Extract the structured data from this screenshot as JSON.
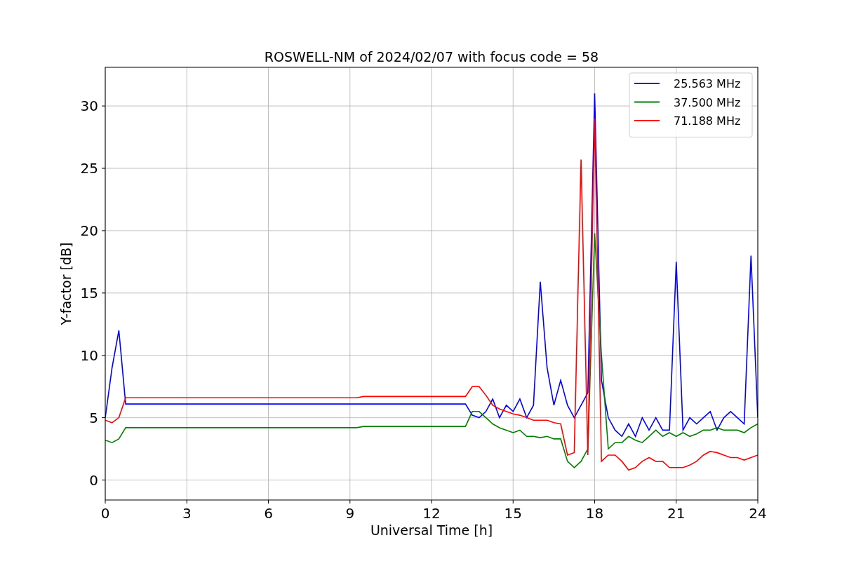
{
  "figure": {
    "chart_data": {
      "type": "line",
      "grid": true,
      "legend": true,
      "title": "ROSWELL-NM of 2024/02/07 with focus code = 58",
      "xlabel": "Universal Time [h]",
      "ylabel": "Y-factor [dB]",
      "xlim": [
        0,
        24
      ],
      "ylim": [
        -1.6,
        33.1
      ],
      "xticks": [
        0,
        3,
        6,
        9,
        12,
        15,
        18,
        21,
        24
      ],
      "yticks": [
        0,
        5,
        10,
        15,
        20,
        25,
        30
      ],
      "x": [
        0,
        0.25,
        0.5,
        0.75,
        1,
        1.25,
        1.5,
        1.75,
        2,
        2.25,
        2.5,
        2.75,
        3,
        3.25,
        3.5,
        3.75,
        4,
        4.25,
        4.5,
        4.75,
        5,
        5.25,
        5.5,
        5.75,
        6,
        6.25,
        6.5,
        6.75,
        7,
        7.25,
        7.5,
        7.75,
        8,
        8.25,
        8.5,
        8.75,
        9,
        9.25,
        9.5,
        9.75,
        10,
        10.25,
        10.5,
        10.75,
        11,
        11.25,
        11.5,
        11.75,
        12,
        12.25,
        12.5,
        12.75,
        13,
        13.25,
        13.5,
        13.75,
        14,
        14.25,
        14.5,
        14.75,
        15,
        15.25,
        15.5,
        15.75,
        16,
        16.25,
        16.5,
        16.75,
        17,
        17.25,
        17.5,
        17.75,
        18,
        18.25,
        18.5,
        18.75,
        19,
        19.25,
        19.5,
        19.75,
        20,
        20.25,
        20.5,
        20.75,
        21,
        21.25,
        21.5,
        21.75,
        22,
        22.25,
        22.5,
        22.75,
        23,
        23.25,
        23.5,
        23.75,
        24
      ],
      "series": [
        {
          "name": "25.563 MHz",
          "color": "#0000ff",
          "values": [
            5,
            9,
            12,
            6.1,
            6.1,
            6.1,
            6.1,
            6.1,
            6.1,
            6.1,
            6.1,
            6.1,
            6.1,
            6.1,
            6.1,
            6.1,
            6.1,
            6.1,
            6.1,
            6.1,
            6.1,
            6.1,
            6.1,
            6.1,
            6.1,
            6.1,
            6.1,
            6.1,
            6.1,
            6.1,
            6.1,
            6.1,
            6.1,
            6.1,
            6.1,
            6.1,
            6.1,
            6.1,
            6.1,
            6.1,
            6.1,
            6.1,
            6.1,
            6.1,
            6.1,
            6.1,
            6.1,
            6.1,
            6.1,
            6.1,
            6.1,
            6.1,
            6.1,
            6.1,
            5.2,
            5,
            5.5,
            6.5,
            5,
            6,
            5.5,
            6.5,
            5,
            6,
            15.9,
            9,
            6,
            8,
            6,
            5,
            6,
            7,
            31,
            8,
            5,
            4,
            3.5,
            4.5,
            3.5,
            5,
            4,
            5,
            4,
            4,
            17.5,
            4,
            5,
            4.5,
            5,
            5.5,
            4,
            5,
            5.5,
            5,
            4.5,
            18,
            5
          ]
        },
        {
          "name": "37.500 MHz",
          "color": "#008000",
          "values": [
            3.2,
            3,
            3.3,
            4.2,
            4.2,
            4.2,
            4.2,
            4.2,
            4.2,
            4.2,
            4.2,
            4.2,
            4.2,
            4.2,
            4.2,
            4.2,
            4.2,
            4.2,
            4.2,
            4.2,
            4.2,
            4.2,
            4.2,
            4.2,
            4.2,
            4.2,
            4.2,
            4.2,
            4.2,
            4.2,
            4.2,
            4.2,
            4.2,
            4.2,
            4.2,
            4.2,
            4.2,
            4.2,
            4.3,
            4.3,
            4.3,
            4.3,
            4.3,
            4.3,
            4.3,
            4.3,
            4.3,
            4.3,
            4.3,
            4.3,
            4.3,
            4.3,
            4.3,
            4.3,
            5.5,
            5.5,
            5,
            4.5,
            4.2,
            4,
            3.8,
            4,
            3.5,
            3.5,
            3.4,
            3.5,
            3.3,
            3.3,
            1.5,
            1,
            1.5,
            2.5,
            19.8,
            10,
            2.5,
            3,
            3,
            3.5,
            3.2,
            3,
            3.5,
            4,
            3.5,
            3.8,
            3.5,
            3.8,
            3.5,
            3.7,
            4,
            4,
            4.2,
            4,
            4,
            4,
            3.8,
            4.2,
            4.5
          ]
        },
        {
          "name": "71.188 MHz",
          "color": "#ff0000",
          "values": [
            4.8,
            4.6,
            5,
            6.6,
            6.6,
            6.6,
            6.6,
            6.6,
            6.6,
            6.6,
            6.6,
            6.6,
            6.6,
            6.6,
            6.6,
            6.6,
            6.6,
            6.6,
            6.6,
            6.6,
            6.6,
            6.6,
            6.6,
            6.6,
            6.6,
            6.6,
            6.6,
            6.6,
            6.6,
            6.6,
            6.6,
            6.6,
            6.6,
            6.6,
            6.6,
            6.6,
            6.6,
            6.6,
            6.7,
            6.7,
            6.7,
            6.7,
            6.7,
            6.7,
            6.7,
            6.7,
            6.7,
            6.7,
            6.7,
            6.7,
            6.7,
            6.7,
            6.7,
            6.7,
            7.5,
            7.5,
            6.8,
            6,
            5.7,
            5.5,
            5.3,
            5.2,
            5,
            4.8,
            4.8,
            4.8,
            4.6,
            4.5,
            2,
            2.2,
            25.7,
            2,
            29,
            1.5,
            2,
            2,
            1.5,
            0.8,
            1,
            1.5,
            1.8,
            1.5,
            1.5,
            1,
            1,
            1,
            1.2,
            1.5,
            2,
            2.3,
            2.2,
            2,
            1.8,
            1.8,
            1.6,
            1.8,
            2
          ]
        }
      ]
    }
  }
}
